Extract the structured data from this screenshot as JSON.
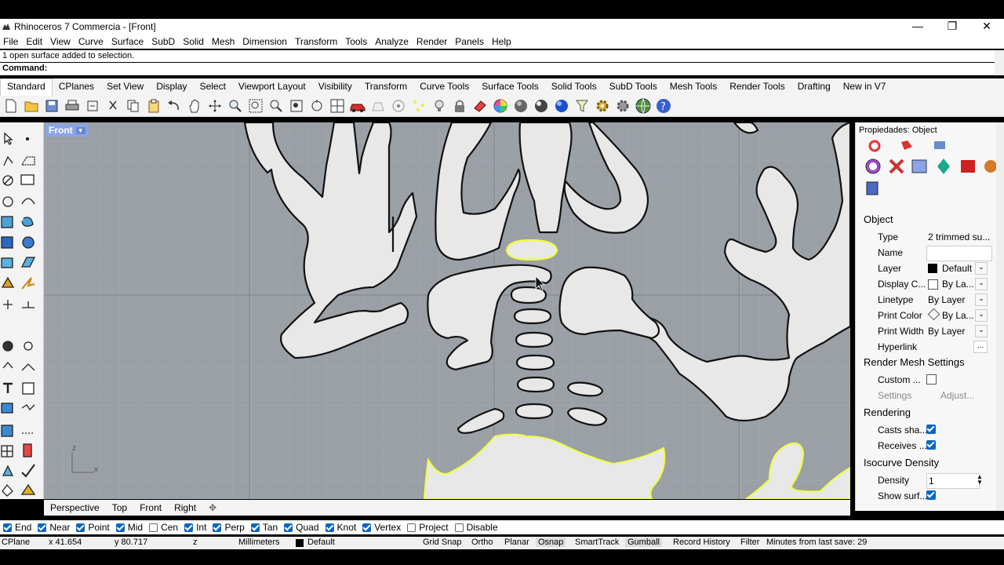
{
  "window": {
    "title": "Rhinoceros 7 Commercia - [Front]",
    "controls": [
      "—",
      "❐",
      "✕"
    ]
  },
  "menu": [
    "File",
    "Edit",
    "View",
    "Curve",
    "Surface",
    "SubD",
    "Solid",
    "Mesh",
    "Dimension",
    "Transform",
    "Tools",
    "Analyze",
    "Render",
    "Panels",
    "Help"
  ],
  "command": {
    "history": "1 open surface added to selection.",
    "prompt": "Command:",
    "value": ""
  },
  "tabs": [
    "Standard",
    "CPlanes",
    "Set View",
    "Display",
    "Select",
    "Viewport Layout",
    "Visibility",
    "Transform",
    "Curve Tools",
    "Surface Tools",
    "Solid Tools",
    "SubD Tools",
    "Mesh Tools",
    "Render Tools",
    "Drafting",
    "New in V7"
  ],
  "viewport": {
    "name": "Front",
    "axis_z": "z",
    "axis_x": "x",
    "bg": "#9aa0a6",
    "grid": "#a5abb1",
    "shape_fill": "#e8e8e8",
    "selected": "#f2ff3a"
  },
  "viewtabs": [
    "Perspective",
    "Top",
    "Front",
    "Right"
  ],
  "properties": {
    "header": "Propiedades: Object",
    "section_object": "Object",
    "rows": [
      {
        "label": "Type",
        "value": "2 trimmed su..."
      },
      {
        "label": "Name",
        "value": ""
      },
      {
        "label": "Layer",
        "value": "Default"
      },
      {
        "label": "Display C...",
        "value": "By La..."
      },
      {
        "label": "Linetype",
        "value": "By Layer"
      },
      {
        "label": "Print Color",
        "value": "By La..."
      },
      {
        "label": "Print Width",
        "value": "By Layer"
      },
      {
        "label": "Hyperlink",
        "value": ""
      }
    ],
    "hyperlink_button": "...",
    "section_render_mesh": "Render Mesh Settings",
    "custom_label": "Custom ...",
    "settings_label": "Settings",
    "adjust_label": "Adjust...",
    "section_rendering": "Rendering",
    "casts_label": "Casts sha...",
    "receives_label": "Receives ...",
    "section_isocurve": "Isocurve Density",
    "density_label": "Density",
    "density_value": "1",
    "showsurf_label": "Show surf..."
  },
  "osnaps": [
    {
      "label": "End",
      "on": true
    },
    {
      "label": "Near",
      "on": true
    },
    {
      "label": "Point",
      "on": true
    },
    {
      "label": "Mid",
      "on": true
    },
    {
      "label": "Cen",
      "on": false
    },
    {
      "label": "Int",
      "on": true
    },
    {
      "label": "Perp",
      "on": true
    },
    {
      "label": "Tan",
      "on": true
    },
    {
      "label": "Quad",
      "on": true
    },
    {
      "label": "Knot",
      "on": true
    },
    {
      "label": "Vertex",
      "on": true
    },
    {
      "label": "Project",
      "on": false
    },
    {
      "label": "Disable",
      "on": false
    }
  ],
  "status": {
    "cplane": "CPlane",
    "x": "x 41.654",
    "y": "y 80.717",
    "z": "z",
    "units": "Millimeters",
    "layer": "Default",
    "grid_snap": "Grid Snap",
    "ortho": "Ortho",
    "planar": "Planar",
    "osnap": "Osnap",
    "smarttrack": "SmartTrack",
    "gumball": "Gumball",
    "record_history": "Record History",
    "filter": "Filter",
    "minutes": "Minutes from last save: 29"
  }
}
